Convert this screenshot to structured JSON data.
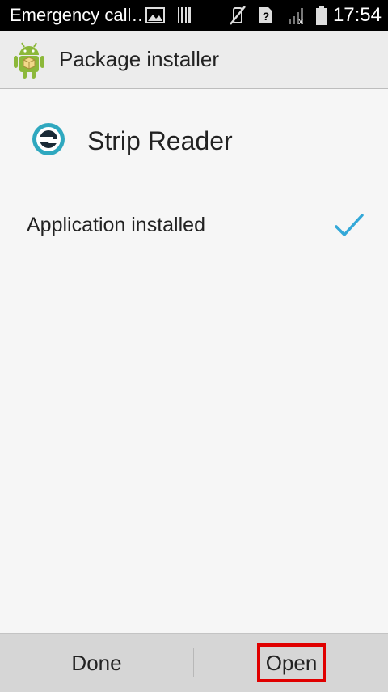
{
  "status_bar": {
    "left_text": "Emergency call…",
    "time": "17:54",
    "icons": [
      "image-icon",
      "barcode-icon",
      "vibrate-off-icon",
      "sim-unknown-icon",
      "signal-no-service-icon",
      "battery-icon"
    ]
  },
  "action_bar": {
    "icon": "android-package-icon",
    "title": "Package installer"
  },
  "app": {
    "icon": "strip-reader-app-icon",
    "name": "Strip Reader"
  },
  "install_status": {
    "text": "Application installed",
    "icon": "checkmark-icon"
  },
  "buttons": {
    "done": "Done",
    "open": "Open"
  },
  "colors": {
    "accent": "#33a8d8",
    "android_green": "#8cb83a",
    "highlight_border": "#e00000"
  }
}
